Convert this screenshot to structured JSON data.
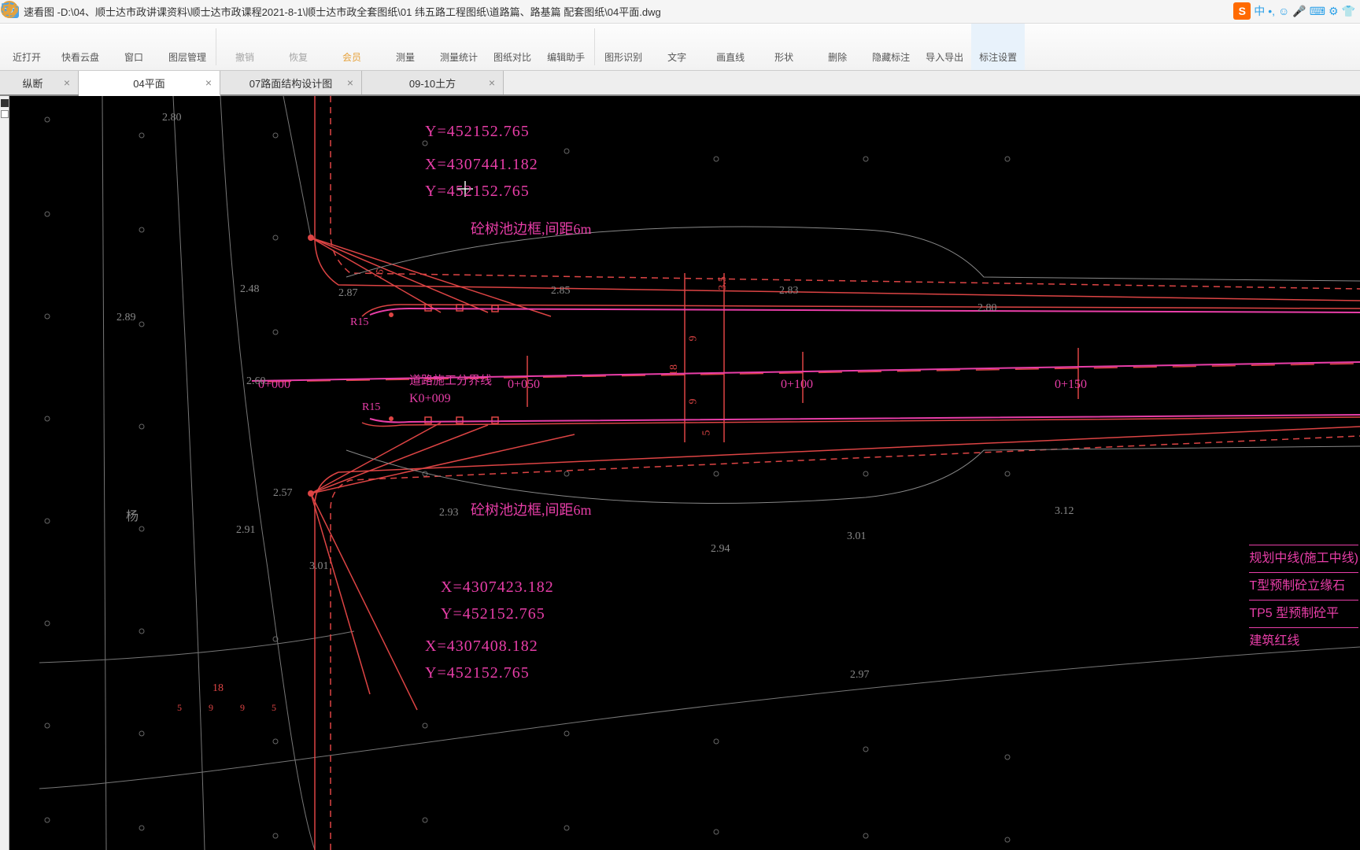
{
  "title_prefix": "速看图 - ",
  "filepath": "D:\\04、顺士达市政讲课资料\\顺士达市政课程2021-8-1\\顺士达市政全套图纸\\01 纬五路工程图纸\\道路篇、路基篇 配套图纸\\04平面.dwg",
  "ime": {
    "logo": "S",
    "lang": "中"
  },
  "toolbar": [
    {
      "id": "recent",
      "label": "近打开"
    },
    {
      "id": "cloud",
      "label": "快看云盘"
    },
    {
      "id": "window",
      "label": "窗口"
    },
    {
      "id": "layer",
      "label": "图层管理"
    },
    {
      "id": "sep"
    },
    {
      "id": "undo",
      "label": "撤销"
    },
    {
      "id": "redo",
      "label": "恢复"
    },
    {
      "id": "vip",
      "label": "会员"
    },
    {
      "id": "measure",
      "label": "测量"
    },
    {
      "id": "mstats",
      "label": "测量统计"
    },
    {
      "id": "compare",
      "label": "图纸对比"
    },
    {
      "id": "helper",
      "label": "编辑助手"
    },
    {
      "id": "sep"
    },
    {
      "id": "recognize",
      "label": "图形识别"
    },
    {
      "id": "text",
      "label": "文字"
    },
    {
      "id": "line",
      "label": "画直线"
    },
    {
      "id": "shape",
      "label": "形状"
    },
    {
      "id": "delete",
      "label": "删除"
    },
    {
      "id": "hide",
      "label": "隐藏标注"
    },
    {
      "id": "import",
      "label": "导入导出"
    },
    {
      "id": "settings",
      "label": "标注设置"
    }
  ],
  "tabs": [
    {
      "label": "纵断",
      "active": false,
      "first": true
    },
    {
      "label": "04平面",
      "active": true
    },
    {
      "label": "07路面结构设计图",
      "active": false
    },
    {
      "label": "09-10土方",
      "active": false
    }
  ],
  "coords": {
    "c1": "Y=452152.765",
    "c2": "X=4307441.182",
    "c3": "Y=452152.765",
    "c4": "X=4307423.182",
    "c5": "Y=452152.765",
    "c6": "X=4307408.182",
    "c7": "Y=452152.765"
  },
  "annotations": {
    "tree_top": "砼树池边框,间距6m",
    "tree_bot": "砼树池边框,间距6m",
    "divide": "道路施工分界线",
    "k0": "K0+009",
    "r15a": "R15",
    "r15b": "R15"
  },
  "stations": {
    "s0": "0+000",
    "s50": "0+050",
    "s100": "0+100",
    "s150": "0+150"
  },
  "elevations": {
    "e280": "2.80",
    "e289": "2.89",
    "e248": "2.48",
    "e287": "2.87",
    "e285": "2.85",
    "e283": "2.83",
    "e280r": "2.80",
    "e260": "2.60",
    "e257": "2.57",
    "e291": "2.91",
    "e293": "2.93",
    "e294": "2.94",
    "e301": "3.01",
    "e301b": "3.01",
    "e297": "2.97",
    "e312": "3.12",
    "e15": "15",
    "e18": "18",
    "e9": "9",
    "e5": "5",
    "e35": "3.5"
  },
  "legend": {
    "l1": "规划中线(施工中线)",
    "l2": "T型预制砼立缘石",
    "l3": "TP5 型预制砼平",
    "l4": "建筑红线"
  },
  "misc": {
    "yang": "杨",
    "dim18": "18",
    "dim5": "5",
    "dim9": "9",
    "dim9b": "9",
    "dim5b": "5"
  }
}
